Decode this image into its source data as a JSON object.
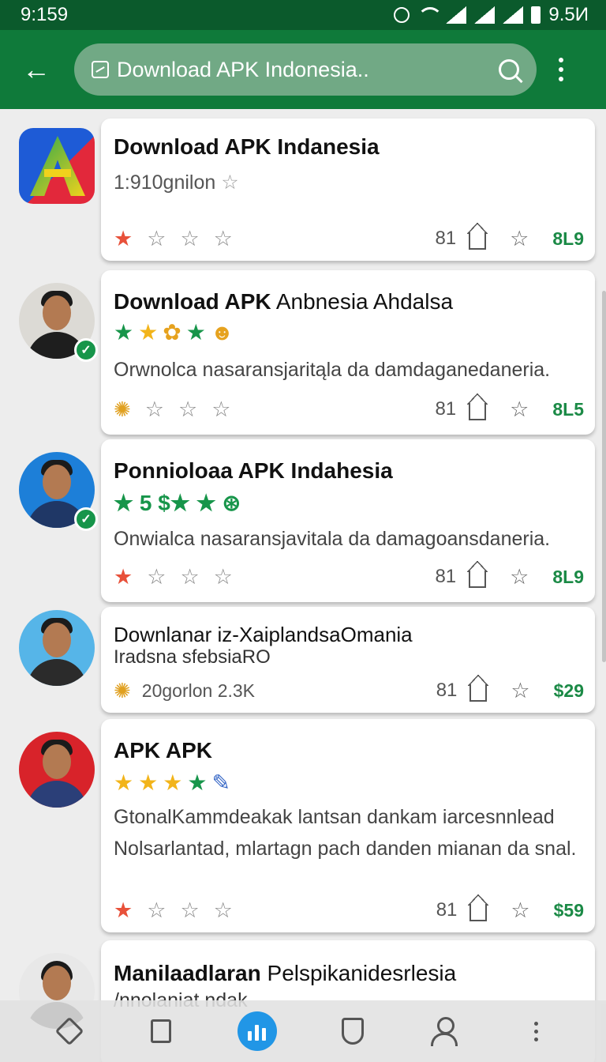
{
  "status_bar": {
    "time": "9:159",
    "battery": "9.5И"
  },
  "app_bar": {
    "search_text": "Download APK Indonesia.."
  },
  "items": [
    {
      "title": "Download APK Indanesia",
      "subtitle": "1:910gnilon",
      "stars": [
        "★",
        "☆",
        "☆",
        "☆"
      ],
      "count": "81",
      "price": "8L9"
    },
    {
      "title_bold": "Download APK",
      "title_light": " Anbnesia Ahdalsa",
      "rating_icons": "★ ★ ✿ ★ ☻",
      "description": "Orwnolca nasaransjaritąla da damdaganedaneria.",
      "stars": [
        "✺",
        "☆",
        "☆",
        "☆"
      ],
      "count": "81",
      "price": "8L5"
    },
    {
      "title": "Ponnioloaa APK Indahesia",
      "rating_text": "★ 5 $★ ★ ⊛",
      "description": "Onwialca nasaransjavitala da damagoansdaneria.",
      "stars": [
        "★",
        "☆",
        "☆",
        "☆"
      ],
      "count": "81",
      "price": "8L9"
    },
    {
      "title": "Downlanar iz-XaiplandsaOmania",
      "subtitle": "Iradsna sfebsiaRO",
      "rating_text": "20gorlon 2.3K",
      "count": "81",
      "price": "$29"
    },
    {
      "title": "APK APK",
      "rating_icons": "★ ★ ★ ★ ✎",
      "description": "GtonalKammdeakak lantsan dankam iarcesnnlead Nolsarlantad, mlartagn pach danden mianan da snal.",
      "stars": [
        "★",
        "☆",
        "☆",
        "☆"
      ],
      "count": "81",
      "price": "$59"
    },
    {
      "title_bold": "Manilaadlaran",
      "title_light": " Pelspikanidesrlesia",
      "subtitle": "/nnolaniat ndak"
    }
  ],
  "colors": {
    "status_bar": "#0b5a2c",
    "app_bar": "#0f7a3a",
    "accent": "#17954a",
    "nav_active": "#2196e6"
  }
}
